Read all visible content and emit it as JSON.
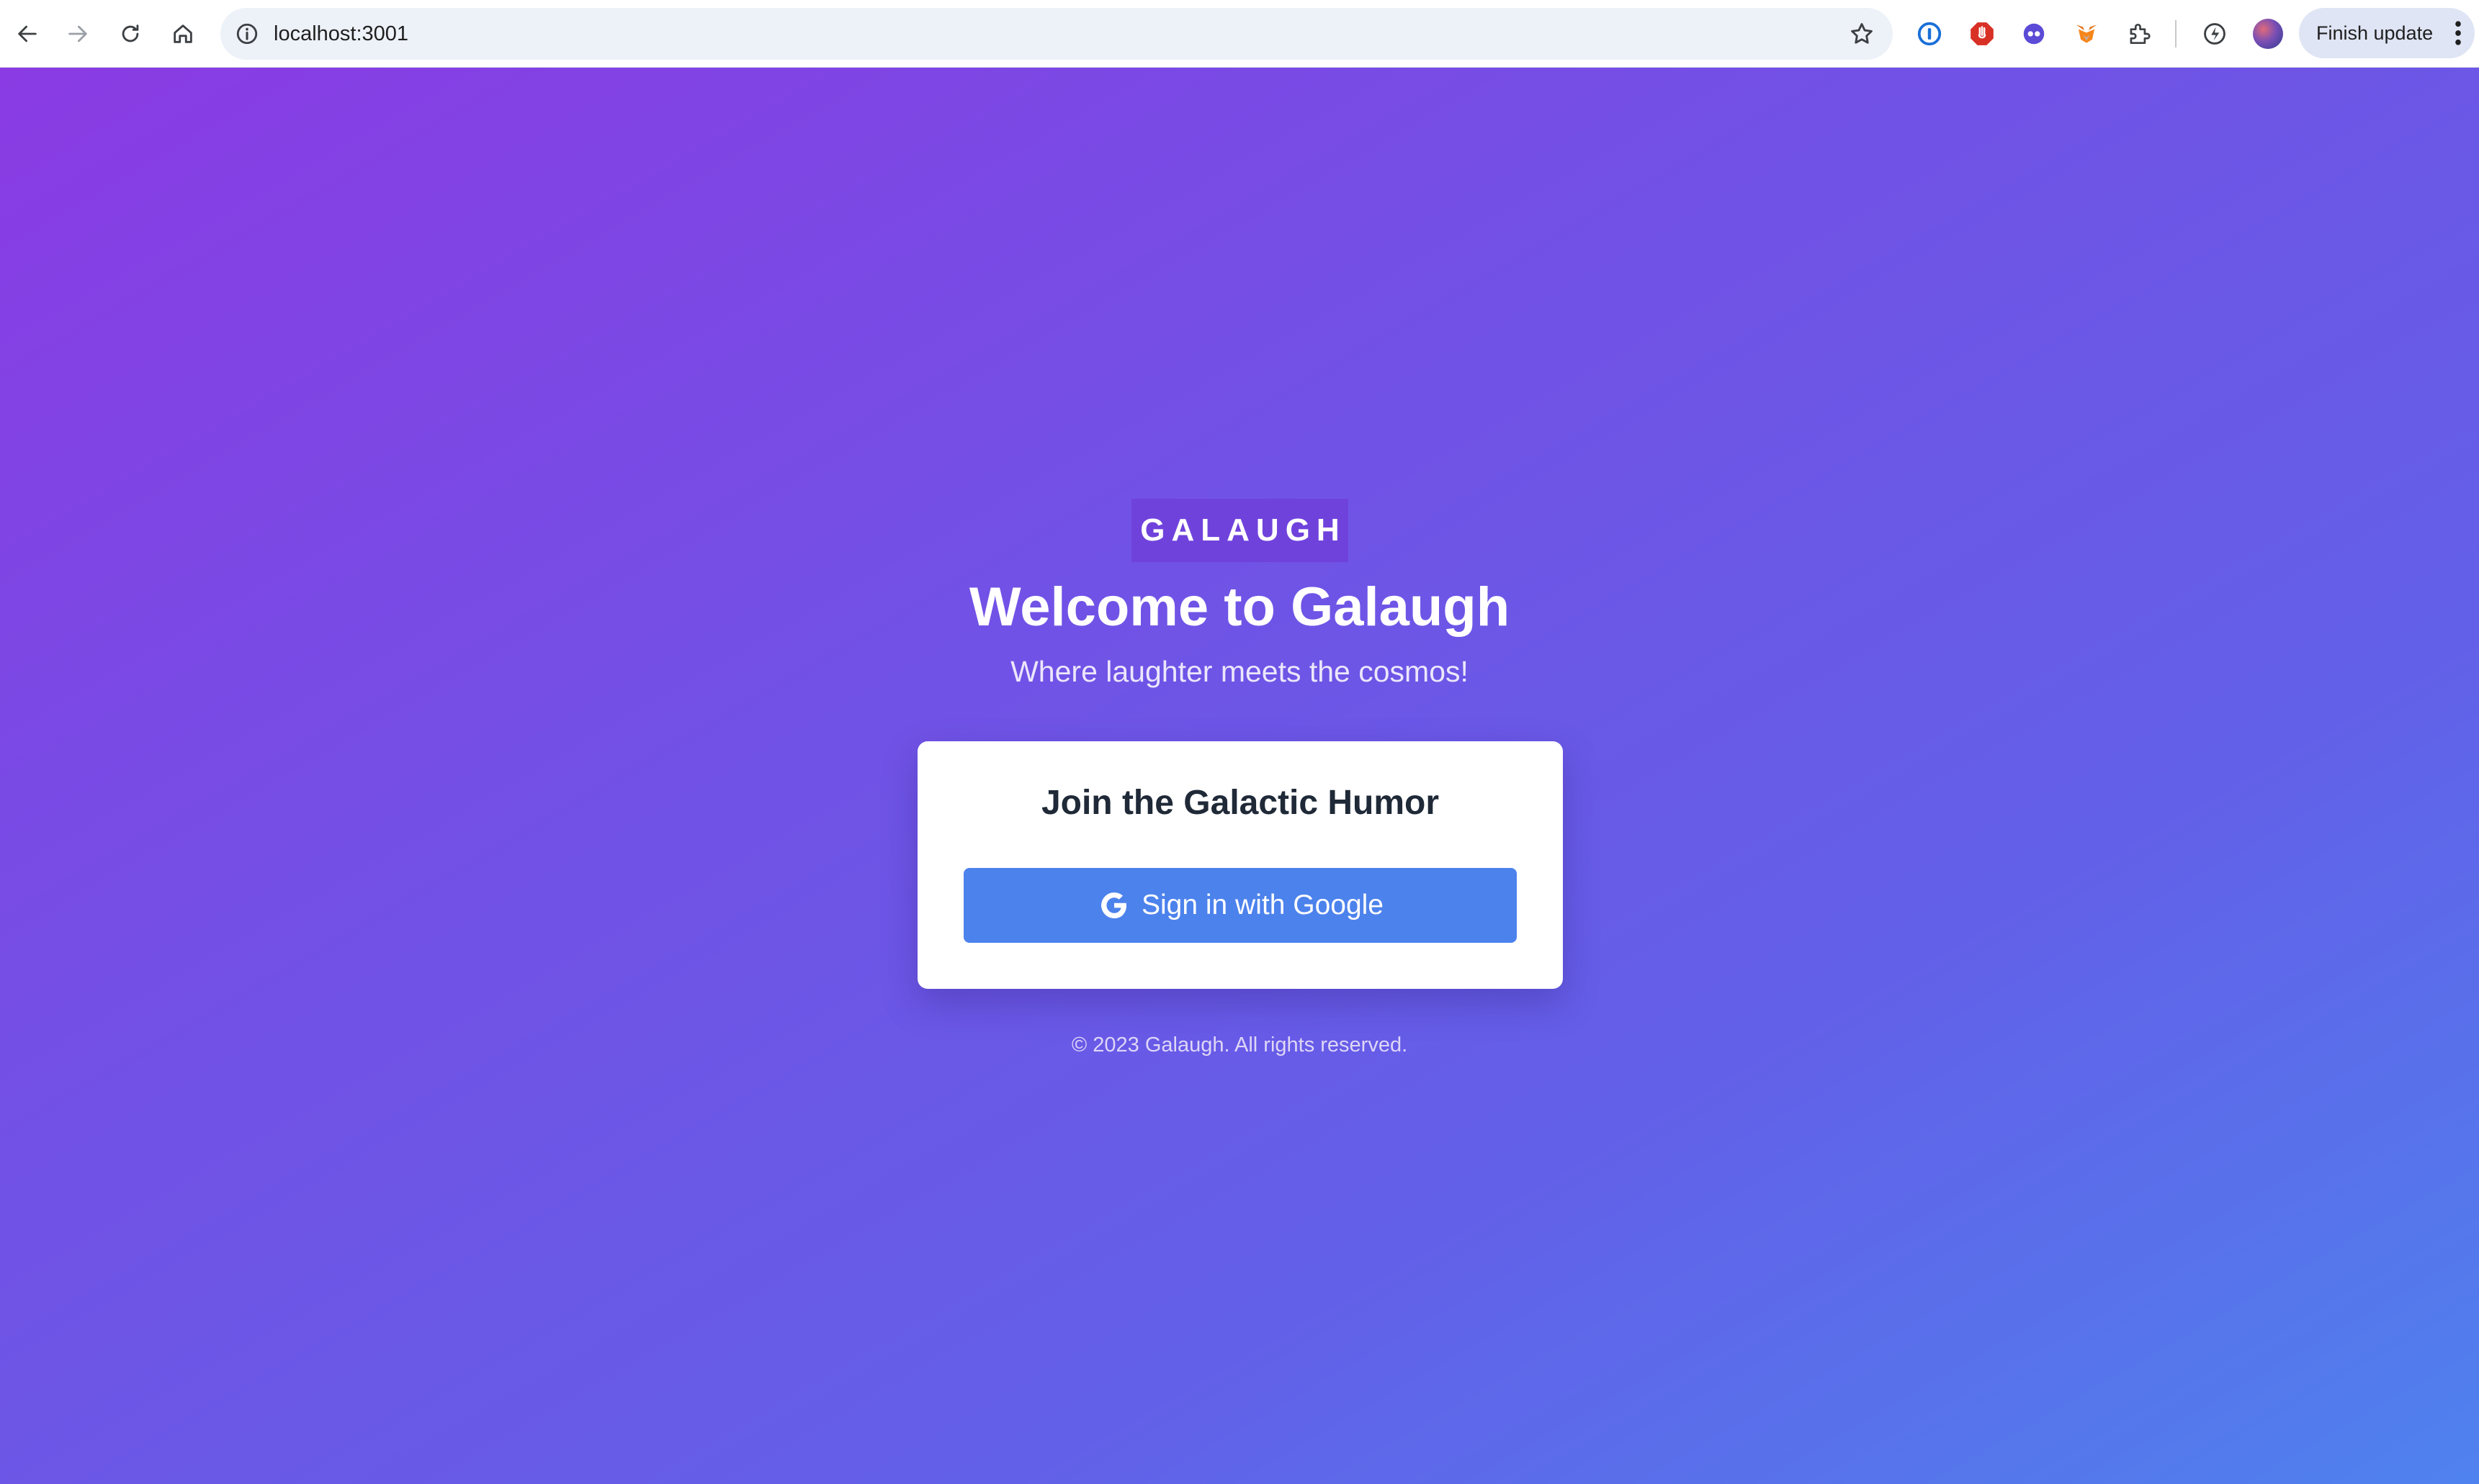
{
  "browser": {
    "url": "localhost:3001",
    "finish_update_label": "Finish update",
    "nav": {
      "back_icon": "arrow-left-icon",
      "forward_icon": "arrow-right-icon",
      "reload_icon": "reload-icon",
      "home_icon": "home-icon"
    },
    "extensions": [
      "1password-icon",
      "adblock-icon",
      "dark-reader-icon",
      "metamask-icon",
      "puzzle-icon",
      "performance-icon"
    ]
  },
  "page": {
    "brand": "GALAUGH",
    "headline": "Welcome to Galaugh",
    "tagline": "Where laughter meets the cosmos!",
    "card": {
      "title": "Join the Galactic Humor",
      "sign_in_label": "Sign in with Google",
      "sign_in_icon": "google-g-icon"
    },
    "footer": "© 2023 Galaugh. All rights reserved.",
    "colors": {
      "gradient_start": "#8a3be3",
      "gradient_end": "#4f82ee",
      "button": "#4c82ec",
      "brand_box": "#7042dc"
    }
  }
}
